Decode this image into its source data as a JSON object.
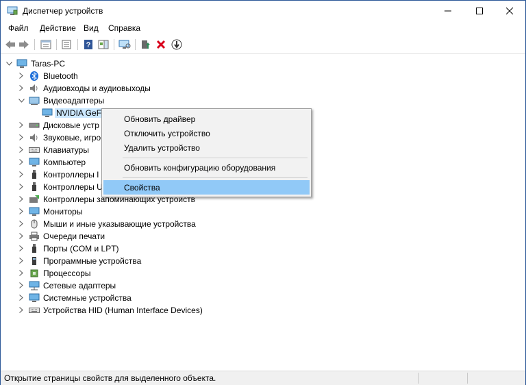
{
  "window": {
    "title": "Диспетчер устройств"
  },
  "menu": [
    "Файл",
    "Действие",
    "Вид",
    "Справка"
  ],
  "toolbar": {
    "icons": [
      "back-arrow-icon",
      "forward-arrow-icon",
      "properties-view-icon",
      "device-list-icon",
      "help-icon",
      "action-pane-icon",
      "scan-monitor-icon",
      "update-driver-icon",
      "uninstall-x-icon",
      "disable-device-icon"
    ]
  },
  "tree": {
    "root": "Taras-PC",
    "nodes": [
      {
        "label": "Bluetooth",
        "icon": "bluetooth-icon",
        "expanded": false
      },
      {
        "label": "Аудиовходы и аудиовыходы",
        "icon": "speaker-icon",
        "expanded": false
      },
      {
        "label": "Видеоадаптеры",
        "icon": "display-adapter-icon",
        "expanded": true
      },
      {
        "label": "NVIDIA GeFo",
        "icon": "monitor-icon",
        "child": true,
        "selected": true
      },
      {
        "label": "Дисковые устр",
        "icon": "disk-drive-icon",
        "expanded": false
      },
      {
        "label": "Звуковые, игро",
        "icon": "sound-icon",
        "expanded": false
      },
      {
        "label": "Клавиатуры",
        "icon": "keyboard-icon",
        "expanded": false
      },
      {
        "label": "Компьютер",
        "icon": "computer-icon",
        "expanded": false
      },
      {
        "label": "Контроллеры I",
        "icon": "usb-icon",
        "expanded": false
      },
      {
        "label": "Контроллеры U",
        "icon": "usb-icon",
        "expanded": false
      },
      {
        "label": "Контроллеры запоминающих устройств",
        "icon": "storage-controller-icon",
        "expanded": false
      },
      {
        "label": "Мониторы",
        "icon": "monitor-icon",
        "expanded": false
      },
      {
        "label": "Мыши и иные указывающие устройства",
        "icon": "mouse-icon",
        "expanded": false
      },
      {
        "label": "Очереди печати",
        "icon": "printer-icon",
        "expanded": false
      },
      {
        "label": "Порты (COM и LPT)",
        "icon": "port-icon",
        "expanded": false
      },
      {
        "label": "Программные устройства",
        "icon": "software-device-icon",
        "expanded": false
      },
      {
        "label": "Процессоры",
        "icon": "processor-icon",
        "expanded": false
      },
      {
        "label": "Сетевые адаптеры",
        "icon": "network-adapter-icon",
        "expanded": false
      },
      {
        "label": "Системные устройства",
        "icon": "system-device-icon",
        "expanded": false
      },
      {
        "label": "Устройства HID (Human Interface Devices)",
        "icon": "hid-icon",
        "expanded": false
      }
    ]
  },
  "context_menu": {
    "items": [
      {
        "label": "Обновить драйвер"
      },
      {
        "label": "Отключить устройство"
      },
      {
        "label": "Удалить устройство"
      },
      {
        "separator": true
      },
      {
        "label": "Обновить конфигурацию оборудования"
      },
      {
        "separator": true
      },
      {
        "label": "Свойства",
        "highlighted": true
      }
    ]
  },
  "status": {
    "text": "Открытие страницы свойств для выделенного объекта."
  },
  "colors": {
    "highlight": "#91c9f7",
    "selection": "#cce8ff",
    "red": "#d9001b",
    "green": "#2e8b57"
  }
}
